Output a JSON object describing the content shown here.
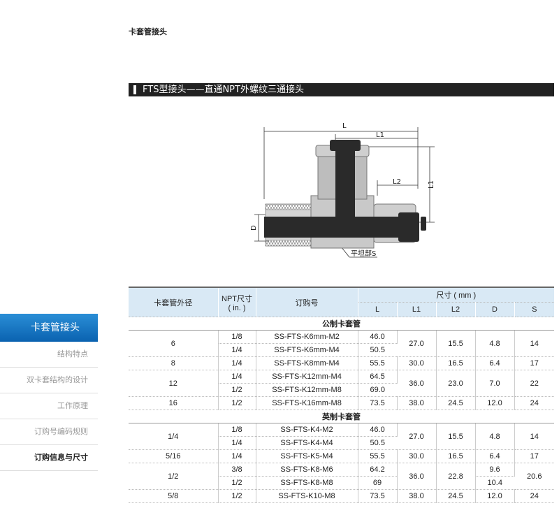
{
  "header": {
    "title": "卡套管接头"
  },
  "banner": {
    "title": "FTS型接头——直通NPT外螺纹三通接头"
  },
  "diagram": {
    "labels": {
      "L": "L",
      "L1_top": "L1",
      "L2": "L2",
      "L1_right": "L1",
      "D": "D",
      "S": "平坦部S"
    },
    "colors": {
      "metal": "#c9c9c9",
      "body_dark": "#2a2a2a"
    }
  },
  "sidebar": {
    "active": "卡套管接头",
    "items": [
      {
        "label": "结构特点"
      },
      {
        "label": "双卡套结构的设计"
      },
      {
        "label": "工作原理"
      },
      {
        "label": "订购号编码规则"
      },
      {
        "label": "订购信息与尺寸"
      }
    ]
  },
  "table": {
    "headers": {
      "tube_od": "卡套管外径",
      "npt": "NPT尺寸",
      "npt_unit": "( in. )",
      "order_no": "订购号",
      "dims": "尺寸 ( mm )",
      "L": "L",
      "L1": "L1",
      "L2": "L2",
      "D": "D",
      "S": "S"
    },
    "metric_title": "公制卡套管",
    "imperial_title": "英制卡套管",
    "metric": [
      {
        "od": "6",
        "npt": "1/8",
        "no": "SS-FTS-K6mm-M2",
        "L": "46.0",
        "L1": "27.0",
        "L2": "15.5",
        "D": "4.8",
        "S": "14"
      },
      {
        "npt": "1/4",
        "no": "SS-FTS-K6mm-M4",
        "L": "50.5"
      },
      {
        "od": "8",
        "npt": "1/4",
        "no": "SS-FTS-K8mm-M4",
        "L": "55.5",
        "L1": "30.0",
        "L2": "16.5",
        "D": "6.4",
        "S": "17"
      },
      {
        "od": "12",
        "npt": "1/4",
        "no": "SS-FTS-K12mm-M4",
        "L": "64.5",
        "L1": "36.0",
        "L2": "23.0",
        "D": "7.0",
        "S": "22"
      },
      {
        "npt": "1/2",
        "no": "SS-FTS-K12mm-M8",
        "L": "69.0"
      },
      {
        "od": "16",
        "npt": "1/2",
        "no": "SS-FTS-K16mm-M8",
        "L": "73.5",
        "L1": "38.0",
        "L2": "24.5",
        "D": "12.0",
        "S": "24"
      }
    ],
    "imperial": [
      {
        "od": "1/4",
        "npt": "1/8",
        "no": "SS-FTS-K4-M2",
        "L": "46.0",
        "L1": "27.0",
        "L2": "15.5",
        "D": "4.8",
        "S": "14"
      },
      {
        "npt": "1/4",
        "no": "SS-FTS-K4-M4",
        "L": "50.5"
      },
      {
        "od": "5/16",
        "npt": "1/4",
        "no": "SS-FTS-K5-M4",
        "L": "55.5",
        "L1": "30.0",
        "L2": "16.5",
        "D": "6.4",
        "S": "17"
      },
      {
        "od": "1/2",
        "npt": "3/8",
        "no": "SS-FTS-K8-M6",
        "L": "64.2",
        "L1": "36.0",
        "L2": "22.8",
        "D": "9.6",
        "S": "20.6"
      },
      {
        "npt": "1/2",
        "no": "SS-FTS-K8-M8",
        "L": "69",
        "D": "10.4"
      },
      {
        "od": "5/8",
        "npt": "1/2",
        "no": "SS-FTS-K10-M8",
        "L": "73.5",
        "L1": "38.0",
        "L2": "24.5",
        "D": "12.0",
        "S": "24"
      }
    ]
  }
}
